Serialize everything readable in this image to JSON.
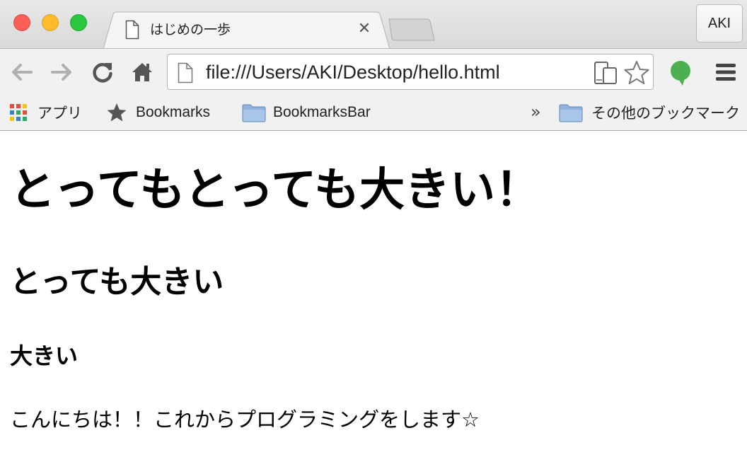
{
  "tab": {
    "title": "はじめの一歩",
    "close_glyph": "✕"
  },
  "profile": {
    "label": "AKI"
  },
  "toolbar": {
    "back_icon": "back-arrow-icon",
    "forward_icon": "forward-arrow-icon",
    "reload_icon": "reload-icon",
    "home_icon": "home-icon",
    "url": "file:///Users/AKI/Desktop/hello.html",
    "extension_icon": "evernote-icon",
    "menu_icon": "hamburger-menu-icon"
  },
  "bookmarks": {
    "apps_label": "アプリ",
    "items": [
      {
        "label": "Bookmarks",
        "icon": "star-icon"
      },
      {
        "label": "BookmarksBar",
        "icon": "folder-icon"
      }
    ],
    "overflow_glyph": "»",
    "other_label": "その他のブックマーク"
  },
  "page": {
    "h1": "とってもとっても大きい！",
    "h2": "とっても大きい",
    "h3": "大きい",
    "paragraph": "こんにちは！！これからプログラミングをします☆"
  },
  "colors": {
    "close_red": "#fc5f57",
    "minimize_yellow": "#fdbc2e",
    "zoom_green": "#29c73f",
    "extension_green": "#4caf50",
    "folder_blue": "#8fb3dc"
  }
}
